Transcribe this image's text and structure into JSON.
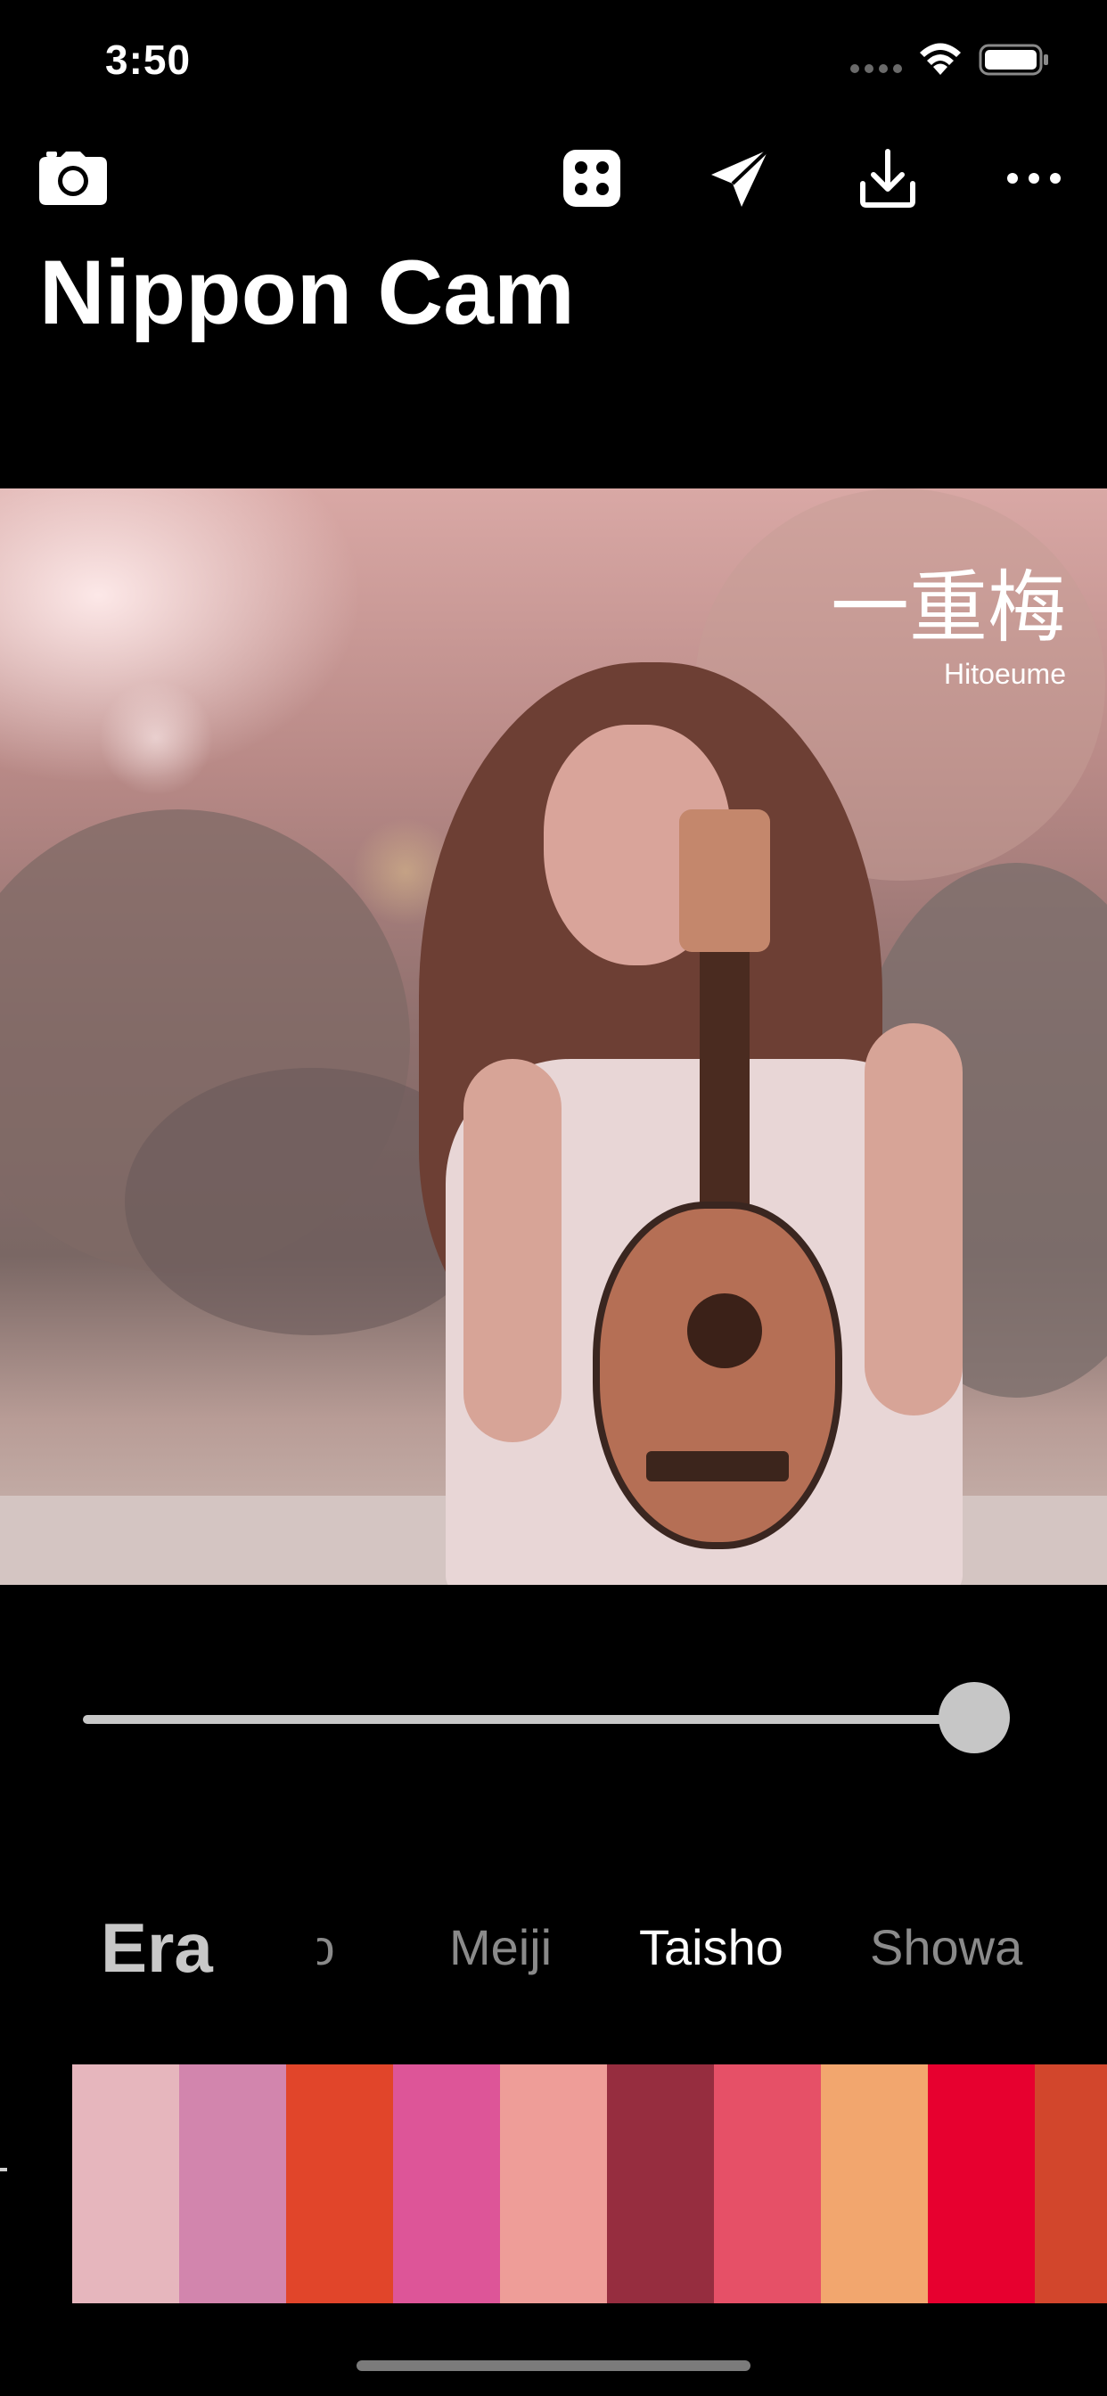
{
  "status_bar": {
    "time": "3:50"
  },
  "toolbar": {
    "camera": "camera-icon",
    "dice": "dice-icon",
    "share": "paper-plane-icon",
    "download": "download-icon",
    "more": "more-icon"
  },
  "title": "Nippon Cam",
  "photo": {
    "color_name_kanji": "一重梅",
    "color_name_romaji": "Hitoeume"
  },
  "slider": {
    "value": 0.98
  },
  "era": {
    "label": "Era",
    "tabs": [
      {
        "label": "Edo",
        "visible_text": "do"
      },
      {
        "label": "Meiji"
      },
      {
        "label": "Taisho",
        "active": true
      },
      {
        "label": "Showa"
      }
    ]
  },
  "swatches": [
    "#e6b6bd",
    "#d285ad",
    "#e1452a",
    "#dd5598",
    "#ee9d98",
    "#962d3f",
    "#e65067",
    "#f2a66e",
    "#e7002f",
    "#d2462c"
  ]
}
